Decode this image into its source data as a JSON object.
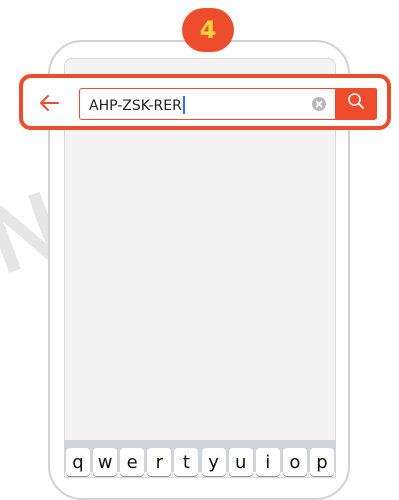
{
  "step": {
    "number": "4"
  },
  "search": {
    "value": "AHP-ZSK-RER",
    "back_icon": "arrow-left-icon",
    "clear_icon": "clear-circle-icon",
    "search_icon": "search-icon"
  },
  "keyboard": {
    "row1": [
      "q",
      "w",
      "e",
      "r",
      "t",
      "y",
      "u",
      "i",
      "o",
      "p"
    ]
  },
  "watermark": "N",
  "colors": {
    "accent": "#ee4d2d",
    "badge_number": "#ffd23f",
    "screen_bg": "#f3f3f3"
  }
}
